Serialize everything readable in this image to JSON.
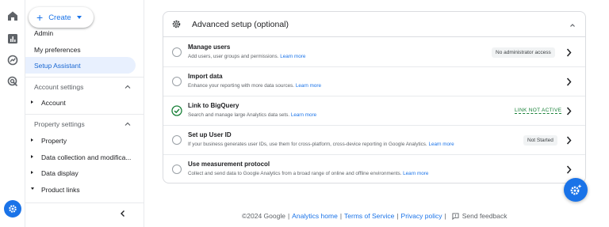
{
  "rail": {
    "icons": [
      "home-icon",
      "reports-icon",
      "explore-icon",
      "advertising-icon"
    ],
    "bottom_icon": "settings-gear-icon"
  },
  "nav": {
    "create_label": "Create",
    "items": [
      "Admin",
      "My preferences"
    ],
    "active_item": "Setup Assistant",
    "account_section": "Account settings",
    "account_items": [
      "Account"
    ],
    "property_section": "Property settings",
    "property_items": [
      "Property",
      "Data collection and modifica...",
      "Data display",
      "Product links"
    ]
  },
  "card": {
    "title": "Advanced setup (optional)",
    "rows": [
      {
        "title": "Manage users",
        "desc": "Add users, user groups and permissions.",
        "link": "Learn more",
        "status": "No administrator access",
        "state": "empty"
      },
      {
        "title": "Import data",
        "desc": "Enhance your reporting with more data sources.",
        "link": "Learn more",
        "status": "",
        "state": "empty"
      },
      {
        "title": "Link to BigQuery",
        "desc": "Search and manage large Analytics data sets.",
        "link": "Learn more",
        "status": "LINK NOT ACTIVE",
        "state": "done"
      },
      {
        "title": "Set up User ID",
        "desc": "If your business generates user IDs, use them for cross-platform, cross-device reporting in Google Analytics.",
        "link": "Learn more",
        "status": "Not Started",
        "state": "empty"
      },
      {
        "title": "Use measurement protocol",
        "desc": "Collect and send data to Google Analytics from a broad range of online and offline environments.",
        "link": "Learn more",
        "status": "",
        "state": "empty"
      }
    ]
  },
  "footer": {
    "copyright": "©2024 Google",
    "links": [
      "Analytics home",
      "Terms of Service",
      "Privacy policy"
    ],
    "separator": "|",
    "feedback": "Send feedback"
  },
  "colors": {
    "accent": "#1a73e8",
    "active_bg": "#e8f0fe",
    "success": "#188038"
  }
}
